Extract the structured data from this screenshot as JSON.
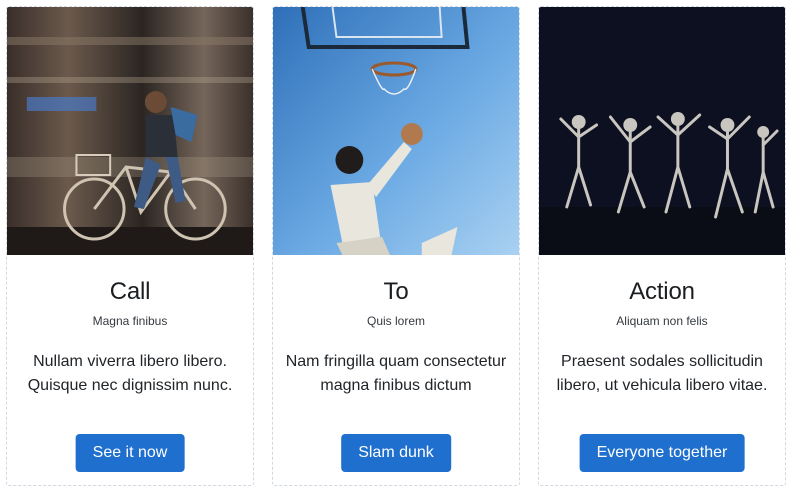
{
  "cards": [
    {
      "title": "Call",
      "subtitle": "Magna finibus",
      "text": "Nullam viverra libero libero. Quisque nec dignissim nunc.",
      "button": "See it now",
      "image": "cyclist-photo"
    },
    {
      "title": "To",
      "subtitle": "Quis lorem",
      "text": "Nam fringilla quam consectetur magna finibus dictum",
      "button": "Slam dunk",
      "image": "basketball-dunk-photo"
    },
    {
      "title": "Action",
      "subtitle": "Aliquam non felis",
      "text": "Praesent sodales sollicitudin libero, ut vehicula libero vitae.",
      "button": "Everyone together",
      "image": "dancers-photo"
    }
  ],
  "colors": {
    "button": "#1e6fce",
    "card_border": "#cfd8e3"
  }
}
